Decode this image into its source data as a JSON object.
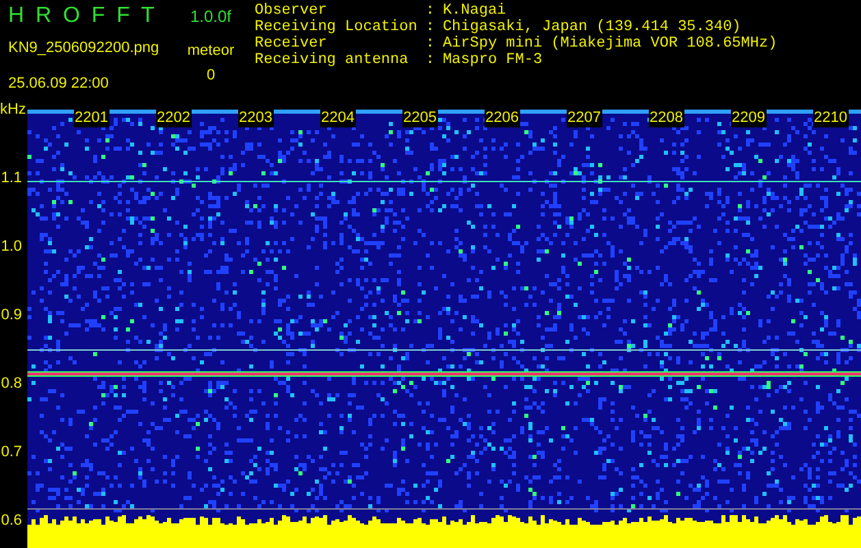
{
  "header": {
    "app_title": "H R O F F T",
    "version": "1.0.0f",
    "filename": "KN9_2506092200.png",
    "timestamp": "25.06.09 22:00",
    "counter_label": "meteor",
    "counter_value": "0"
  },
  "info": [
    {
      "label": "Observer",
      "sep": ":",
      "value": "K.Nagai"
    },
    {
      "label": "Receiving Location",
      "sep": ":",
      "value": "Chigasaki, Japan (139.414 35.340)"
    },
    {
      "label": "Receiver",
      "sep": ":",
      "value": "AirSpy mini (Miakejima VOR 108.65MHz)"
    },
    {
      "label": "Receiving antenna",
      "sep": ":",
      "value": "Maspro FM-3"
    }
  ],
  "plot": {
    "unit": "kHz",
    "y_labels": [
      "1.1",
      "1.0",
      "0.9",
      "0.8",
      "0.7",
      "0.6"
    ],
    "time_labels": [
      "2201",
      "2202",
      "2203",
      "2204",
      "2205",
      "2206",
      "2207",
      "2208",
      "2209",
      "2210"
    ]
  }
}
